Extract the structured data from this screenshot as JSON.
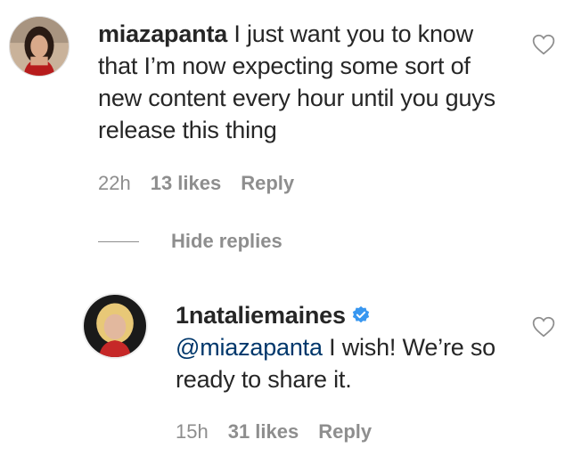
{
  "comment": {
    "username": "miazapanta",
    "text": "I just want you to know that I’m now expecting some sort of new content every hour until you guys release this thing",
    "time": "22h",
    "likes": "13 likes",
    "reply_label": "Reply",
    "avatar_icon": "user-avatar-photo",
    "heart_icon": "heart-outline-icon"
  },
  "replies_toggle": {
    "label": "Hide replies"
  },
  "reply": {
    "username": "1nataliemaines",
    "verified": true,
    "verified_icon": "verified-badge-icon",
    "mention": "@miazapanta",
    "text": "I wish! We’re so ready to share it.",
    "time": "15h",
    "likes": "31 likes",
    "reply_label": "Reply",
    "avatar_icon": "user-avatar-photo",
    "heart_icon": "heart-outline-icon"
  },
  "colors": {
    "text": "#262626",
    "meta": "#8e8e8e",
    "mention": "#00376b",
    "verified": "#3897f0"
  }
}
